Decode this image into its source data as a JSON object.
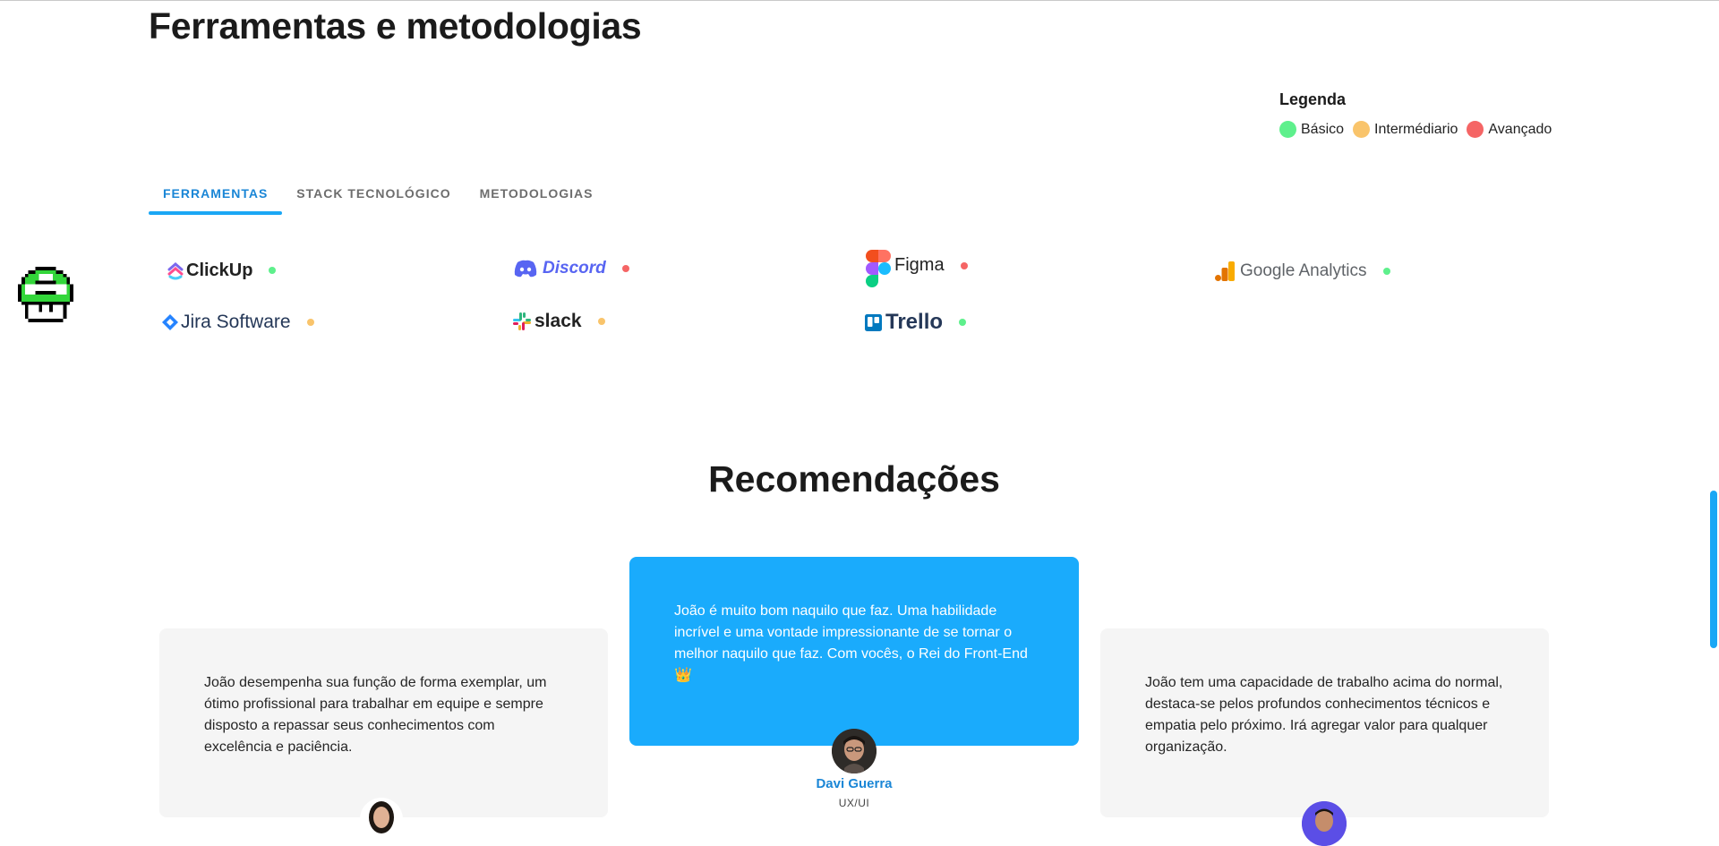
{
  "section": {
    "title": "Ferramentas e metodologias"
  },
  "legend": {
    "title": "Legenda",
    "items": [
      {
        "label": "Básico",
        "color": "#5ef08c"
      },
      {
        "label": "Intermédiario",
        "color": "#f9c46b"
      },
      {
        "label": "Avançado",
        "color": "#f56565"
      }
    ]
  },
  "tabs": [
    {
      "label": "FERRAMENTAS",
      "active": true
    },
    {
      "label": "STACK TECNOLÓGICO",
      "active": false
    },
    {
      "label": "METODOLOGIAS",
      "active": false
    }
  ],
  "tools": [
    {
      "name": "ClickUp",
      "icon": "clickup-logo",
      "level": "Básico"
    },
    {
      "name": "Discord",
      "icon": "discord-logo",
      "level": "Avançado"
    },
    {
      "name": "Figma",
      "icon": "figma-logo",
      "level": "Avançado"
    },
    {
      "name": "Google Analytics",
      "icon": "google-analytics-logo",
      "level": "Básico"
    },
    {
      "name": "Jira Software",
      "icon": "jira-logo",
      "level": "Intermédiario"
    },
    {
      "name": "slack",
      "icon": "slack-logo",
      "level": "Intermédiario"
    },
    {
      "name": "Trello",
      "icon": "trello-logo",
      "level": "Básico"
    }
  ],
  "recommendations": {
    "title": "Recomendações",
    "cards": [
      {
        "text": "João desempenha sua função de forma exemplar, um ótimo profissional para trabalhar em equipe e sempre disposto a repassar seus conhecimentos com excelência e paciência."
      },
      {
        "text": "João é muito bom naquilo que faz. Uma habilidade incrível e uma vontade impressionante de se tornar o melhor naquilo que faz. Com vocês, o Rei do Front-End 👑",
        "name": "Davi Guerra",
        "role": "UX/UI"
      },
      {
        "text": "João tem uma capacidade de trabalho acima do normal, destaca-se pelos profundos conhecimentos técnicos e empatia pelo próximo. Irá agregar valor para qualquer organização."
      }
    ]
  }
}
